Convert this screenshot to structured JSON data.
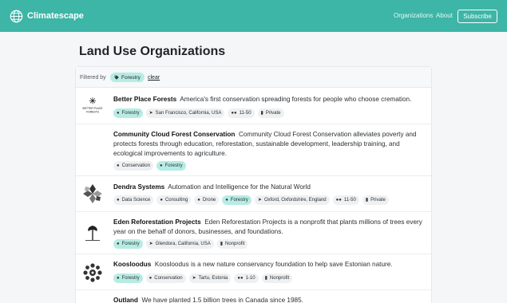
{
  "nav": {
    "brand": "Climatescape",
    "links": [
      "Organizations",
      "About"
    ],
    "subscribe": "Subscribe"
  },
  "page": {
    "title": "Land Use Organizations"
  },
  "filter": {
    "label": "Filtered by",
    "chip": "Forestry",
    "clear": "clear"
  },
  "orgs": [
    {
      "name": "Better Place Forests",
      "description": "America's first conservation spreading forests for people who choose cremation.",
      "logo_text": "BETTER PLACE FORESTS",
      "tags": [
        {
          "icon": "tag-icon",
          "label": "Forestry",
          "highlight": true
        },
        {
          "icon": "location-icon",
          "label": "San Francisco, California, USA"
        },
        {
          "icon": "people-icon",
          "label": "11-50"
        },
        {
          "icon": "building-icon",
          "label": "Private"
        }
      ]
    },
    {
      "name": "Community Cloud Forest Conservation",
      "description": "Community Cloud Forest Conservation alleviates poverty and protects forests through education, reforestation, sustainable development, leadership training, and ecological improvements to agriculture.",
      "tags": [
        {
          "icon": "tag-icon",
          "label": "Conservation"
        },
        {
          "icon": "tag-icon",
          "label": "Forestry",
          "highlight": true
        }
      ]
    },
    {
      "name": "Dendra Systems",
      "description": "Automation and Intelligence for the Natural World",
      "tags": [
        {
          "icon": "tag-icon",
          "label": "Data Science"
        },
        {
          "icon": "tag-icon",
          "label": "Consulting"
        },
        {
          "icon": "tag-icon",
          "label": "Drone"
        },
        {
          "icon": "tag-icon",
          "label": "Forestry",
          "highlight": true
        },
        {
          "icon": "location-icon",
          "label": "Oxford, Oxfordshire, England"
        },
        {
          "icon": "people-icon",
          "label": "11-50"
        },
        {
          "icon": "building-icon",
          "label": "Private"
        }
      ]
    },
    {
      "name": "Eden Reforestation Projects",
      "description": "Eden Reforestation Projects is a nonprofit that plants millions of trees every year on the behalf of donors, businesses, and foundations.",
      "tags": [
        {
          "icon": "tag-icon",
          "label": "Forestry",
          "highlight": true
        },
        {
          "icon": "location-icon",
          "label": "Glendora, California, USA"
        },
        {
          "icon": "building-icon",
          "label": "Nonprofit"
        }
      ]
    },
    {
      "name": "Koosloodus",
      "description": "Koosloodus is a new nature conservancy foundation to help save Estonian nature.",
      "tags": [
        {
          "icon": "tag-icon",
          "label": "Forestry",
          "highlight": true
        },
        {
          "icon": "tag-icon",
          "label": "Conservation"
        },
        {
          "icon": "location-icon",
          "label": "Tartu, Estonia"
        },
        {
          "icon": "people-icon",
          "label": "1-10"
        },
        {
          "icon": "building-icon",
          "label": "Nonprofit"
        }
      ]
    },
    {
      "name": "Outland",
      "description": "We have planted 1.5 billion trees in Canada since 1985.",
      "tags": []
    }
  ]
}
